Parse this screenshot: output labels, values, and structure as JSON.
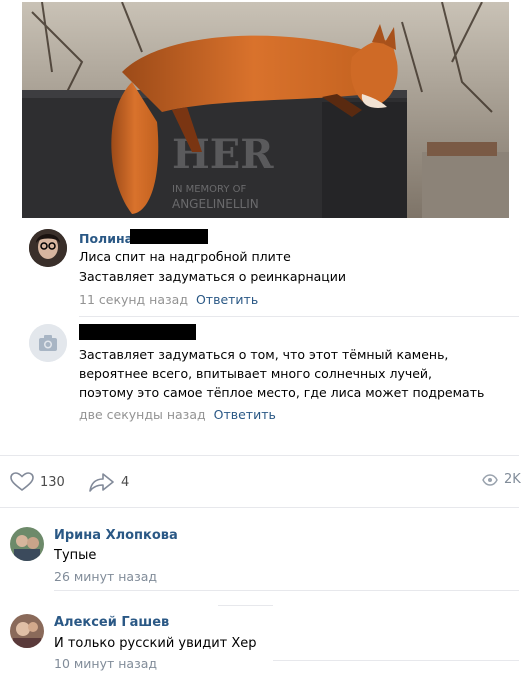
{
  "post": {
    "photo_desc_icon": "fox-on-gravestone-photo",
    "comments": [
      {
        "author": "Полина",
        "lines": [
          "Лиса спит на надгробной плите",
          "Заставляет задуматься о реинкарнации"
        ],
        "time": "11 секунд назад",
        "reply": "Ответить"
      },
      {
        "author": "",
        "lines": [
          "Заставляет задуматься о том, что этот тёмный камень,",
          "вероятнее всего, впитывает много солнечных лучей,",
          "поэтому это самое тёплое место, где лиса может подремать"
        ],
        "time": "две секунды назад",
        "reply": "Ответить"
      }
    ]
  },
  "actions": {
    "likes": "130",
    "shares": "4",
    "views": "2K"
  },
  "comments": [
    {
      "author": "Ирина Хлопкова",
      "text": "Тупые",
      "time": "26 минут назад"
    },
    {
      "author": "Алексей Гашев",
      "text": "И только русский увидит Хер",
      "time": "10 минут назад"
    }
  ],
  "colors": {
    "link": "#2a5885",
    "meta": "#939393",
    "separator": "#e7e8ec"
  }
}
